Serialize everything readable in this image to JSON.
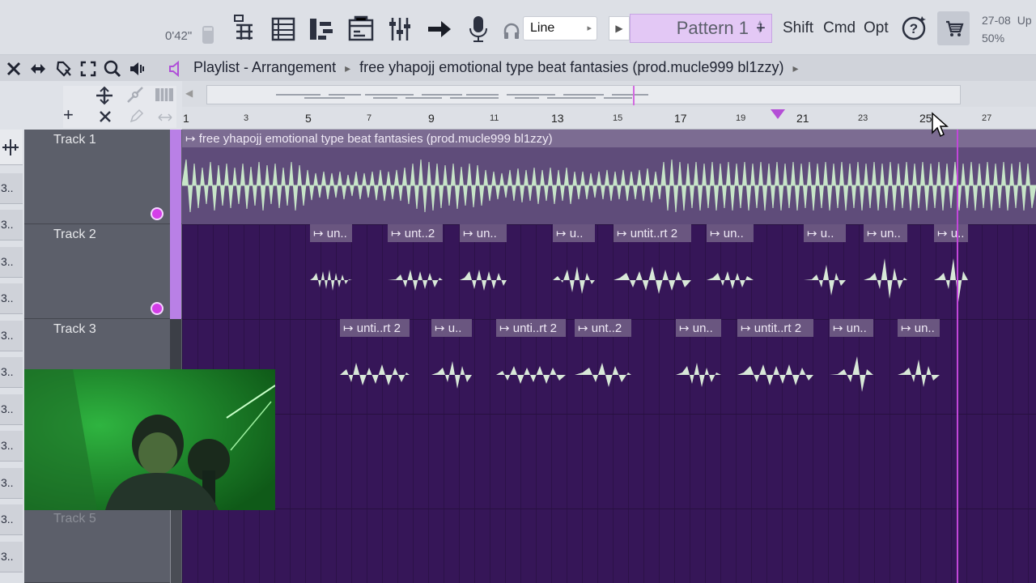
{
  "toolbar": {
    "time": "0'42\"",
    "snap_mode": "Line",
    "pattern": "Pattern 1",
    "modifiers": [
      "Shift",
      "Cmd",
      "Opt"
    ],
    "cpu": {
      "time": "27-08",
      "percent": "50%",
      "extra": "Up"
    }
  },
  "playlist": {
    "title": "Playlist - Arrangement",
    "breadcrumb_arrow": "▸",
    "song": "free yhapojj emotional type beat fantasies (prod.mucle999 bl1zzy)"
  },
  "ruler": {
    "marks": [
      "1",
      "3",
      "5",
      "7",
      "9",
      "11",
      "13",
      "15",
      "17",
      "19",
      "21",
      "23",
      "25",
      "27"
    ]
  },
  "left_strip": {
    "items": [
      "3..",
      "3..",
      "3..",
      "3..",
      "3..",
      "3..",
      "3..",
      "3..",
      "3..",
      "3..",
      "3.."
    ]
  },
  "tracks": [
    {
      "name": "Track 1"
    },
    {
      "name": "Track 2"
    },
    {
      "name": "Track 3"
    },
    {
      "name": "Track 5"
    }
  ],
  "clips": {
    "track1": [
      {
        "label": "free yhapojj emotional type beat fantasies (prod.mucle999 bl1zzy)"
      }
    ],
    "track2": [
      {
        "label": "un.."
      },
      {
        "label": "unt..2"
      },
      {
        "label": "un.."
      },
      {
        "label": "u.."
      },
      {
        "label": "untit..rt 2"
      },
      {
        "label": "un.."
      },
      {
        "label": "u.."
      },
      {
        "label": "un.."
      },
      {
        "label": "u.."
      }
    ],
    "track3": [
      {
        "label": "unti..rt 2"
      },
      {
        "label": "u.."
      },
      {
        "label": "unti..rt 2"
      },
      {
        "label": "unt..2"
      },
      {
        "label": "un.."
      },
      {
        "label": "untit..rt 2"
      },
      {
        "label": "un.."
      },
      {
        "label": "un.."
      }
    ]
  },
  "colors": {
    "accent": "#b44ed6",
    "arrangement_bg": "#361658",
    "clip_header": "#6a5680",
    "wave": "#c7e5c8"
  }
}
